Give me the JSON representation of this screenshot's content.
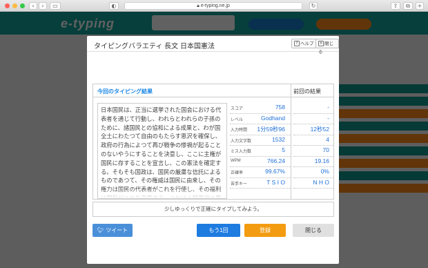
{
  "browser": {
    "url": "e-typing.ne.jp"
  },
  "site": {
    "logo": "e-typing"
  },
  "modal": {
    "title": "タイピングバラエティ 長文 日本国憲法",
    "help_label": "ヘルプ",
    "close_label": "閉じる",
    "current_label": "今回のタイピング結果",
    "previous_label": "前回の結果",
    "text": "日本国民は、正当に選挙された国会における代表者を通じて行動し、われらとわれらの子孫のために、諸国民との協和による成果と、わが国全土にわたつて自由のもたらす恵沢を確保し、政府の行為によつて再び戦争の惨禍が起ることのないやうにすることを決意し、ここに主権が国民に存することを宣言し、この憲法を確定する。そもそも国政は、国民の厳粛な信託によるものであつて、その権威は国民に由来し、その権力は国民の代表者がこれを行使し、その福利は国民がこれを享受する。これは人類普遍の原理であり、この憲法は、かかる原理に基くものである。われらは、これに",
    "stats": [
      {
        "label": "スコア",
        "value": "758",
        "prev": "-"
      },
      {
        "label": "レベル",
        "value": "Godhand",
        "prev": "-"
      },
      {
        "label": "入力時間",
        "value": "1分59秒96",
        "prev": "12秒52"
      },
      {
        "label": "入力文字数",
        "value": "1532",
        "prev": "4"
      },
      {
        "label": "ミス入力数",
        "value": "5",
        "prev": "70"
      },
      {
        "label": "WPM",
        "value": "766.24",
        "prev": "19.16"
      },
      {
        "label": "正確率",
        "value": "99.67%",
        "prev": "0%"
      },
      {
        "label": "苦手キー",
        "value": "T S I O",
        "prev": "N H O"
      }
    ],
    "advice": "少しゆっくりで正確にタイプしてみよう。",
    "tweet_label": "ツイート",
    "again_label": "もう1回",
    "register_label": "登録",
    "close_button_label": "閉じる"
  }
}
